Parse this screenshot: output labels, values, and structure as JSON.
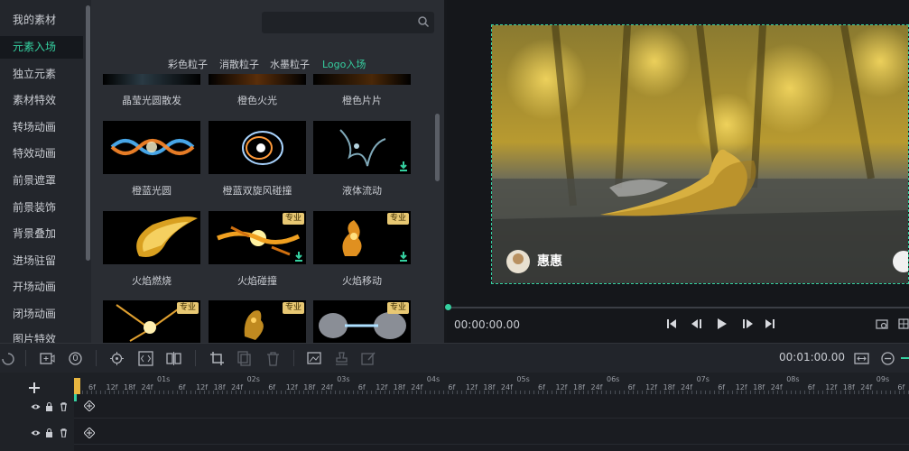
{
  "sidebar": {
    "items": [
      "我的素材",
      "元素入场",
      "独立元素",
      "素材特效",
      "转场动画",
      "特效动画",
      "前景遮罩",
      "前景装饰",
      "背景叠加",
      "进场驻留",
      "开场动画",
      "闭场动画",
      "图片特效"
    ],
    "active_index": 1
  },
  "library": {
    "categories": [
      "彩色粒子",
      "消散粒子",
      "水墨粒子",
      "Logo入场"
    ],
    "active_category_index": 3,
    "top_row_labels": [
      "晶莹光圆散发",
      "橙色火光",
      "橙色片片"
    ],
    "items": [
      {
        "label": "橙蓝光圆",
        "badge": "",
        "download": false
      },
      {
        "label": "橙蓝双旋风碰撞",
        "badge": "",
        "download": false
      },
      {
        "label": "液体流动",
        "badge": "",
        "download": true
      },
      {
        "label": "火焰燃烧",
        "badge": "",
        "download": false
      },
      {
        "label": "火焰碰撞",
        "badge": "专业",
        "download": true
      },
      {
        "label": "火焰移动",
        "badge": "专业",
        "download": true
      },
      {
        "label": "",
        "badge": "专业",
        "download": false
      },
      {
        "label": "",
        "badge": "专业",
        "download": false
      },
      {
        "label": "",
        "badge": "专业",
        "download": false
      }
    ]
  },
  "preview": {
    "watermark": "惠惠",
    "timecode": "00:00:00.00",
    "progress": 0
  },
  "timeline": {
    "time": "00:01:00.00",
    "ruler_seconds": [
      "01s",
      "02s",
      "03s",
      "04s",
      "05s",
      "06s",
      "07s",
      "08s",
      "09s"
    ],
    "ruler_frames": [
      "6f",
      "12f",
      "18f",
      "24f"
    ]
  },
  "colors": {
    "accent": "#35d0a0",
    "badge": "#e8c873"
  }
}
